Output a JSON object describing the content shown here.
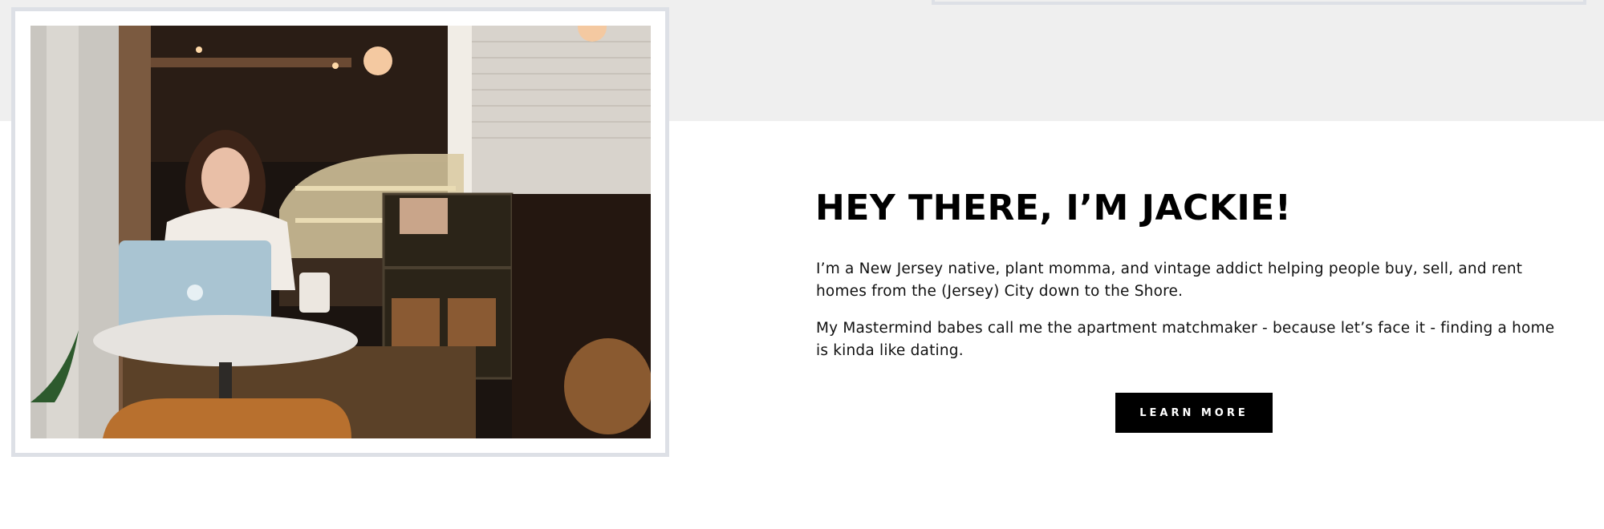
{
  "about": {
    "heading": "HEY THERE, I’M JACKIE!",
    "paragraphs": [
      "I’m a New Jersey native, plant momma, and vintage addict helping people buy, sell, and rent homes from the (Jersey) City down to the Shore.",
      "My Mastermind babes call me the apartment matchmaker - because let’s face it - finding a home is kinda like dating."
    ],
    "cta_label": "LEARN MORE"
  },
  "photo": {
    "subject": "woman-with-laptop-in-cafe"
  },
  "colors": {
    "band": "#efefef",
    "frame": "#dde0e6",
    "button_bg": "#000000",
    "button_text": "#ffffff"
  }
}
